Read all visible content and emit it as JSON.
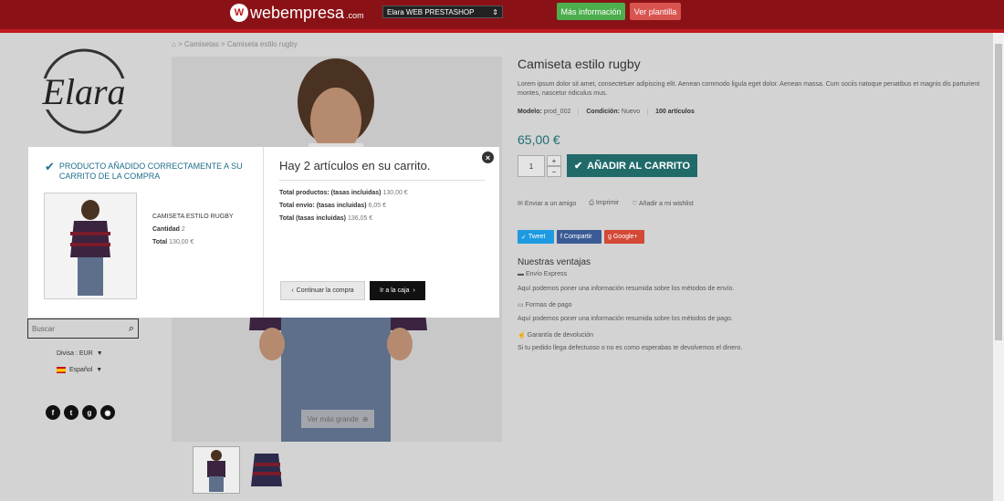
{
  "topbar": {
    "brand": "webempresa",
    "brand_domain": ".com",
    "theme_selector": "Elara WEB PRESTASHOP",
    "more_info": "Más información",
    "view_template": "Ver plantilla"
  },
  "store": {
    "logo_text": "Elara"
  },
  "breadcrumb": [
    "Camisetas",
    "Camiseta estilo rugby"
  ],
  "product": {
    "title": "Camiseta estilo rugby",
    "description": "Lorem ipsum dolor sit amet, consectetuer adipiscing elit. Aenean commodo ligula eget dolor. Aenean massa. Cum sociis natoque penatibus et magnis dis parturient montes, nascetur ridiculus mus.",
    "model_label": "Modelo:",
    "model_value": "prod_002",
    "condition_label": "Condición:",
    "condition_value": "Nuevo",
    "stock": "100 artículos",
    "price": "65,00 €",
    "quantity": "1",
    "add_to_cart": "AÑADIR AL CARRITO",
    "zoom_label": "Ver más grande",
    "actions": [
      "Enviar a un amigo",
      "Imprimir",
      "Añadir a mi wishlist"
    ],
    "share": [
      "Tweet",
      "Compartir",
      "Google+"
    ],
    "sales_title": "Nuestras ventajas",
    "sales": [
      {
        "heading": "Envío Express",
        "text": "Aquí podemos poner una información resumida sobre los métodos de envío."
      },
      {
        "heading": "Formas de pago",
        "text": "Aquí podemos poner una información resumida sobre los métodos de pago."
      },
      {
        "heading": "Garantía de devolución",
        "text": "Si tu pedido llega defectuoso o no es como esperabas te devolvemos el dinero."
      }
    ]
  },
  "sidebar": {
    "search_placeholder": "Buscar",
    "currency": "Divisa : EUR",
    "language": "Español"
  },
  "modal": {
    "success": "PRODUCTO AÑADIDO CORRECTAMENTE A SU CARRITO DE LA COMPRA",
    "product_name": "CAMISETA ESTILO RUGBY",
    "qty_label": "Cantidad",
    "qty_value": "2",
    "total_label": "Total",
    "total_value": "130,00 €",
    "cart_title": "Hay 2 artículos en su carrito.",
    "rows": [
      {
        "label": "Total productos: (tasas incluidas)",
        "value": "130,00 €"
      },
      {
        "label": "Total envío: (tasas incluidas)",
        "value": "6,05 €"
      },
      {
        "label": "Total (tasas incluidas)",
        "value": "136,05 €"
      }
    ],
    "continue": "Continuar la compra",
    "checkout": "Ir a la caja"
  },
  "colors": {
    "topbar": "#8a1216",
    "accent": "#206a6a",
    "twitter": "#1d9ae0",
    "facebook": "#3b5b96",
    "google": "#d34836"
  }
}
